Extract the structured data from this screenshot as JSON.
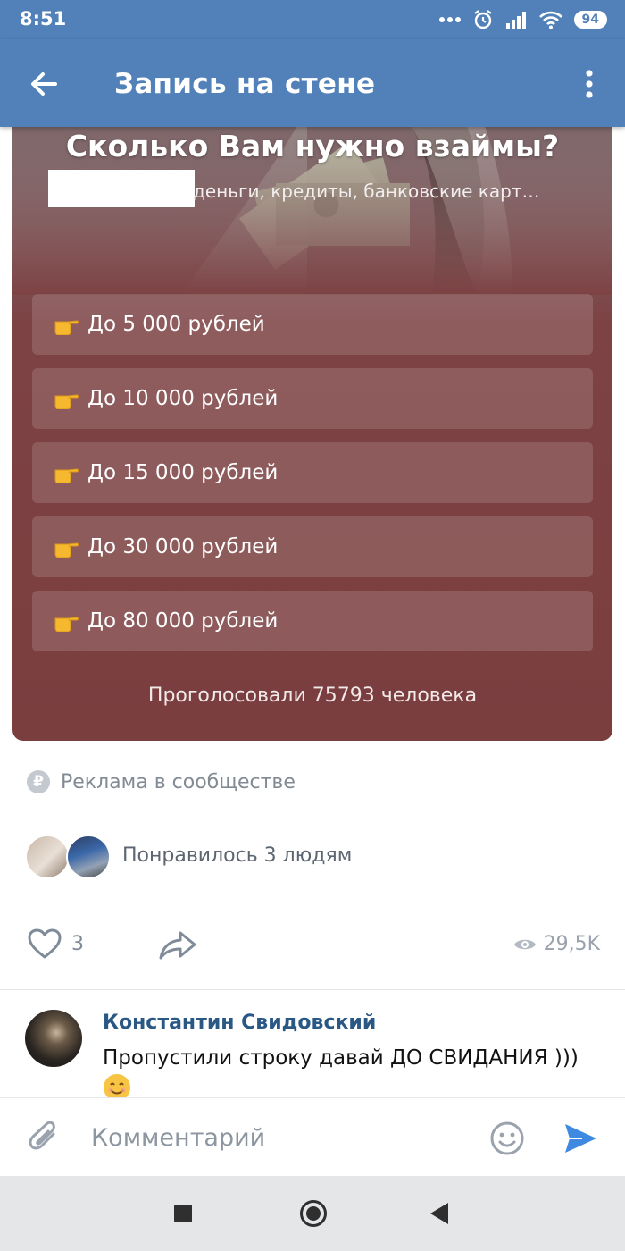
{
  "status_bar": {
    "time": "8:51",
    "battery": "94"
  },
  "header": {
    "title": "Запись на стене"
  },
  "poll": {
    "question": "Сколько Вам нужно взаймы?",
    "subtitle": "деньги, кредиты, банковские карт…",
    "options": [
      {
        "label": "До 5 000 рублей"
      },
      {
        "label": "До 10 000 рублей"
      },
      {
        "label": "До 15 000 рублей"
      },
      {
        "label": "До 30 000 рублей"
      },
      {
        "label": "До 80 000 рублей"
      }
    ],
    "votes_text": "Проголосовали 75793 человека",
    "option_icon": "pointing-hand-icon"
  },
  "ad": {
    "label": "Реклама в сообществе",
    "icon": "ruble-icon",
    "icon_glyph": "₽"
  },
  "likes": {
    "text": "Понравилось 3 людям"
  },
  "actions": {
    "likes_count": "3",
    "views": "29,5K"
  },
  "comment": {
    "author": "Константин Свидовский",
    "text": "Пропустили строку  давай ДО СВИДАНИЯ )))"
  },
  "comment_input": {
    "placeholder": "Комментарий"
  },
  "colors": {
    "header": "#5181b8",
    "poll_bg": "#7b3e3f",
    "link": "#2a5885",
    "send": "#3f8ae0"
  }
}
